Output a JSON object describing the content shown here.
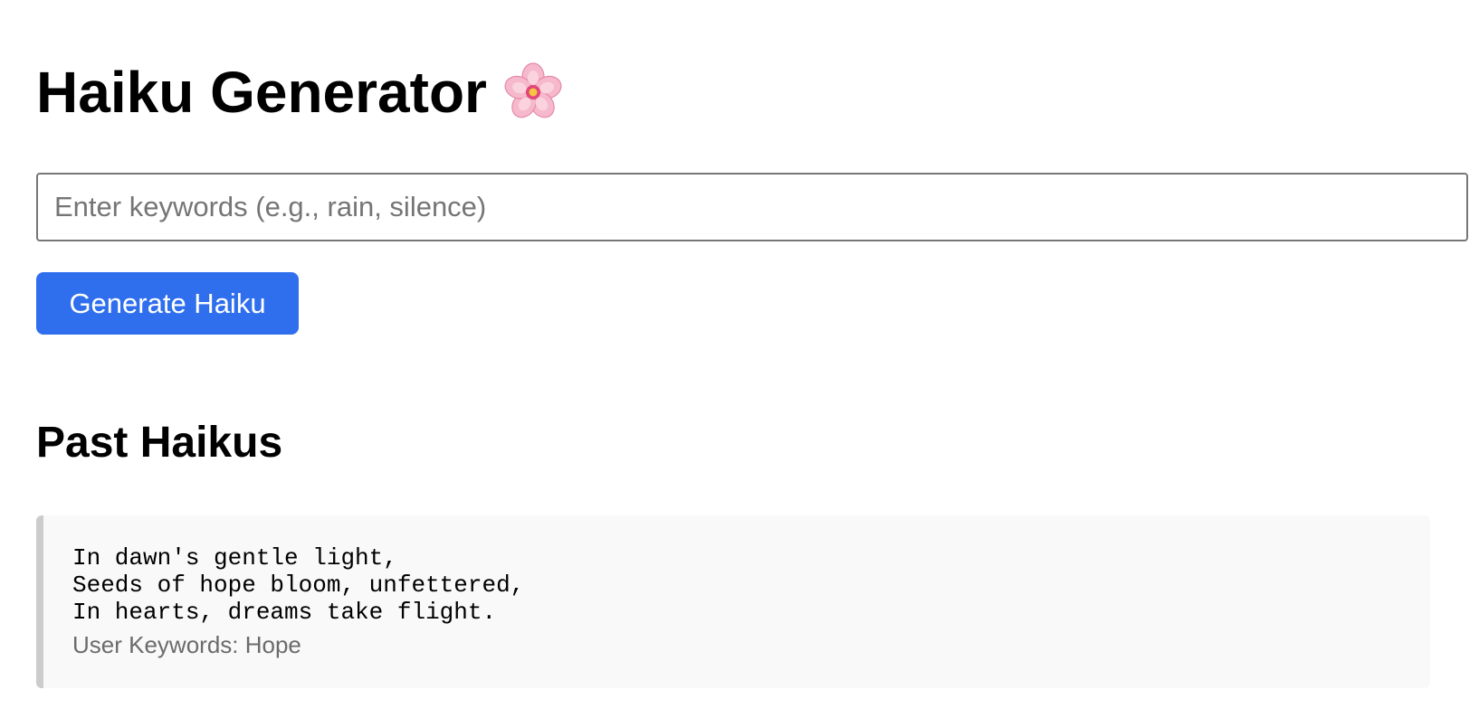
{
  "header": {
    "title": "Haiku Generator",
    "title_icon": "cherry-blossom-icon"
  },
  "form": {
    "keywords_placeholder": "Enter keywords (e.g., rain, silence)",
    "keywords_value": "",
    "generate_label": "Generate Haiku"
  },
  "history": {
    "title": "Past Haikus",
    "items": [
      {
        "text": "In dawn's gentle light,\nSeeds of hope bloom, unfettered,\nIn hearts, dreams take flight.",
        "keywords_line": "User Keywords: Hope"
      }
    ]
  },
  "colors": {
    "accent": "#2f6fed",
    "card_background": "#f9f9f9",
    "card_border": "#cccccc",
    "muted_text": "#6b6b6b"
  }
}
